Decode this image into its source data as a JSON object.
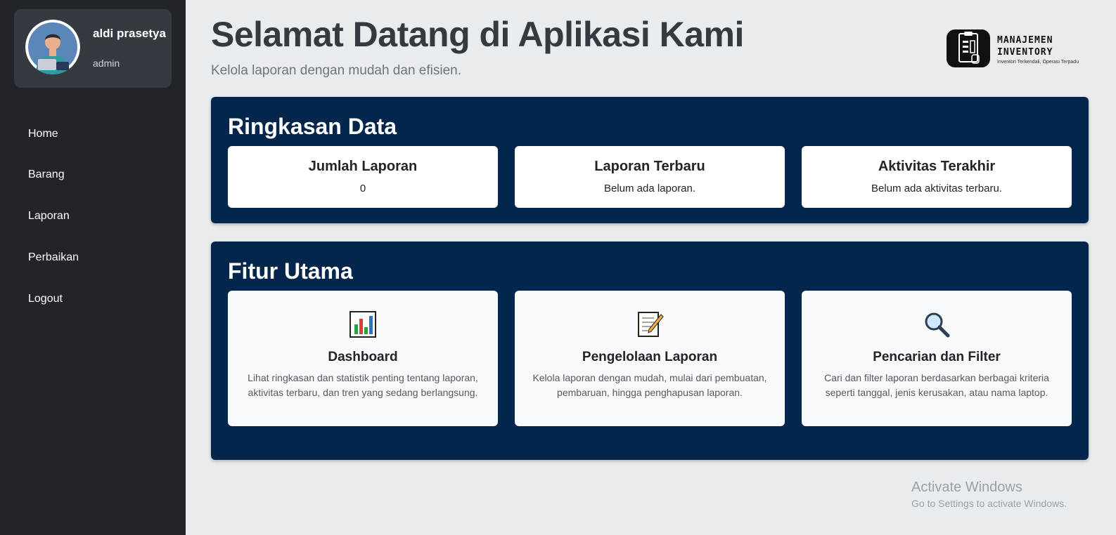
{
  "sidebar": {
    "profile": {
      "name": "aldi prasetya",
      "role": "admin",
      "avatar_icon": "user-avatar-icon"
    },
    "nav": [
      {
        "label": "Home"
      },
      {
        "label": "Barang"
      },
      {
        "label": "Laporan"
      },
      {
        "label": "Perbaikan"
      },
      {
        "label": "Logout"
      }
    ]
  },
  "header": {
    "title": "Selamat Datang di Aplikasi Kami",
    "subtitle": "Kelola laporan dengan mudah dan efisien.",
    "logo": {
      "line1": "MANAJEMEN",
      "line2": "INVENTORY",
      "tagline": "Inventori Terkendali, Operasi Terpadu"
    }
  },
  "summary": {
    "title": "Ringkasan Data",
    "cards": [
      {
        "title": "Jumlah Laporan",
        "value": "0"
      },
      {
        "title": "Laporan Terbaru",
        "value": "Belum ada laporan."
      },
      {
        "title": "Aktivitas Terakhir",
        "value": "Belum ada aktivitas terbaru."
      }
    ]
  },
  "features": {
    "title": "Fitur Utama",
    "cards": [
      {
        "icon": "bar-chart-icon",
        "title": "Dashboard",
        "desc": "Lihat ringkasan dan statistik penting tentang laporan, aktivitas terbaru, dan tren yang sedang berlangsung."
      },
      {
        "icon": "memo-icon",
        "title": "Pengelolaan Laporan",
        "desc": "Kelola laporan dengan mudah, mulai dari pembuatan, pembaruan, hingga penghapusan laporan."
      },
      {
        "icon": "magnifier-icon",
        "title": "Pencarian dan Filter",
        "desc": "Cari dan filter laporan berdasarkan berbagai kriteria seperti tanggal, jenis kerusakan, atau nama laptop."
      }
    ]
  },
  "watermark": {
    "line1": "Activate Windows",
    "line2": "Go to Settings to activate Windows."
  },
  "colors": {
    "sidebar_bg": "#212529",
    "profile_card_bg": "#343a40",
    "panel_bg": "#04264d",
    "page_bg": "#e9ecef"
  }
}
